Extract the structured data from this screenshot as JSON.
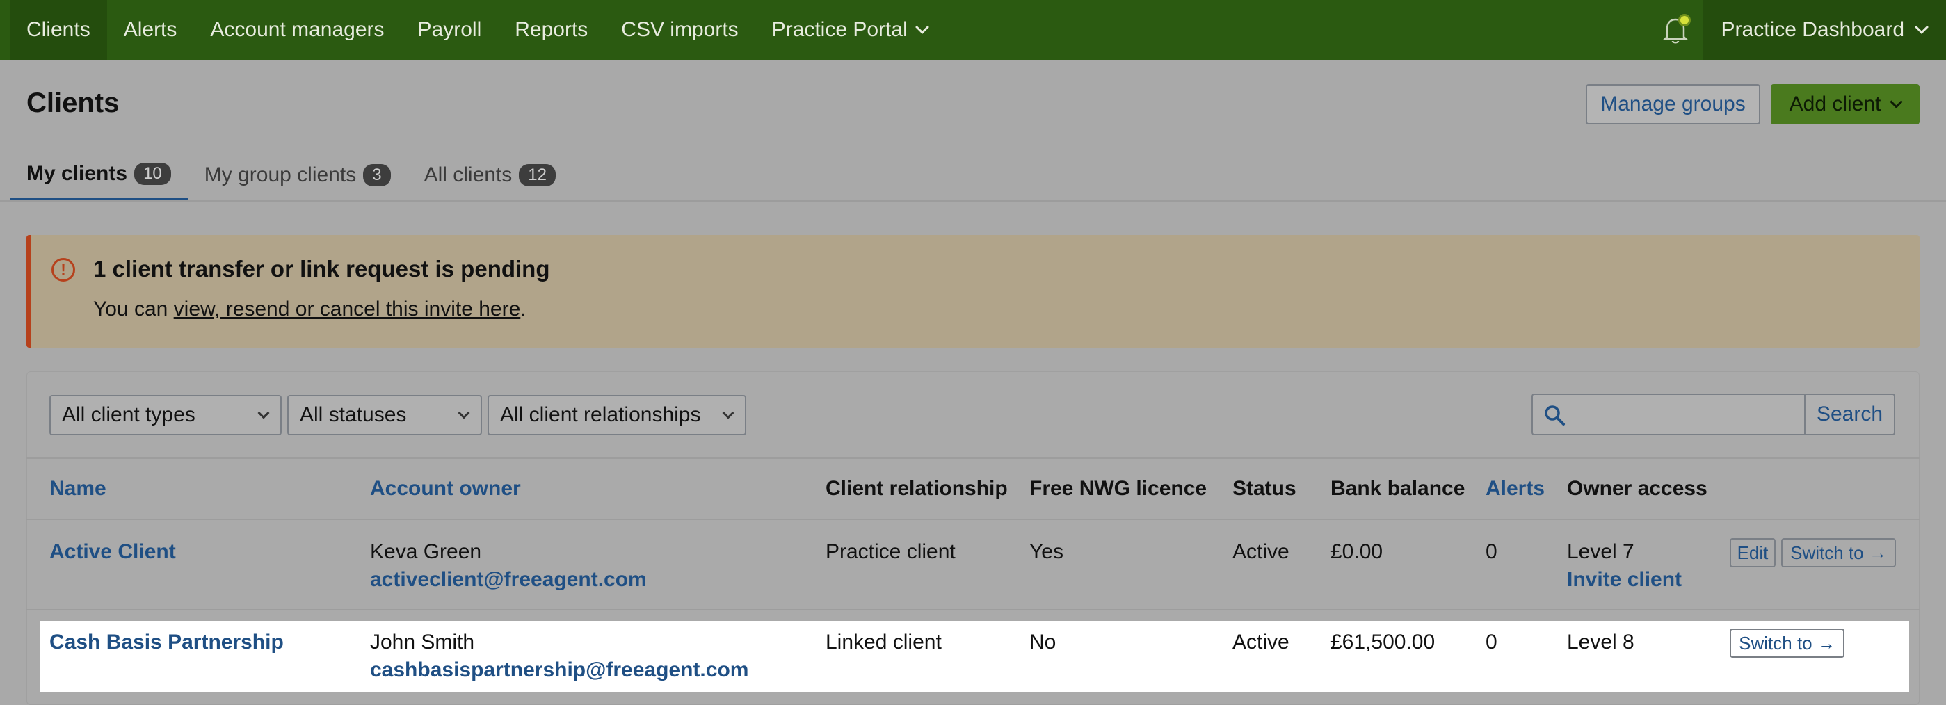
{
  "nav": {
    "items": [
      {
        "label": "Clients"
      },
      {
        "label": "Alerts"
      },
      {
        "label": "Account managers"
      },
      {
        "label": "Payroll"
      },
      {
        "label": "Reports"
      },
      {
        "label": "CSV imports"
      },
      {
        "label": "Practice Portal"
      }
    ],
    "dashboard_label": "Practice Dashboard",
    "active_index": 0
  },
  "header": {
    "title": "Clients",
    "manage_groups_label": "Manage groups",
    "add_client_label": "Add client"
  },
  "tabs": [
    {
      "label": "My clients",
      "count": "10",
      "active": true
    },
    {
      "label": "My group clients",
      "count": "3",
      "active": false
    },
    {
      "label": "All clients",
      "count": "12",
      "active": false
    }
  ],
  "alert": {
    "icon": "exclamation-circle-icon",
    "title": "1 client transfer or link request is pending",
    "text_before": "You can ",
    "link_text": "view, resend or cancel this invite here",
    "text_after": "."
  },
  "filters": {
    "client_types": "All client types",
    "statuses": "All statuses",
    "relationships": "All client relationships",
    "search_placeholder": "",
    "search_label": "Search"
  },
  "table": {
    "headers": {
      "name": "Name",
      "account_owner": "Account owner",
      "client_relationship": "Client relationship",
      "free_nwg_licence": "Free NWG licence",
      "status": "Status",
      "bank_balance": "Bank balance",
      "alerts": "Alerts",
      "owner_access": "Owner access"
    },
    "rows": [
      {
        "name": "Active Client",
        "owner_name": "Keva Green",
        "owner_email": "activeclient@freeagent.com",
        "relationship": "Practice client",
        "nwg": "Yes",
        "status": "Active",
        "balance": "£0.00",
        "alerts": "0",
        "access_level": "Level 7",
        "access_action": "Invite client",
        "edit_label": "Edit",
        "switch_label": "Switch to →"
      },
      {
        "name": "Cash Basis Partnership",
        "owner_name": "John Smith",
        "owner_email": "cashbasispartnership@freeagent.com",
        "relationship": "Linked client",
        "nwg": "No",
        "status": "Active",
        "balance": "£61,500.00",
        "alerts": "0",
        "access_level": "Level 8",
        "switch_label": "Switch to →"
      }
    ]
  },
  "colors": {
    "nav_bg": "#2b5a11",
    "link": "#1f4f84",
    "alert_border": "#b6411c",
    "alert_bg": "#b1a48a",
    "add_button": "#4a7a1e"
  }
}
